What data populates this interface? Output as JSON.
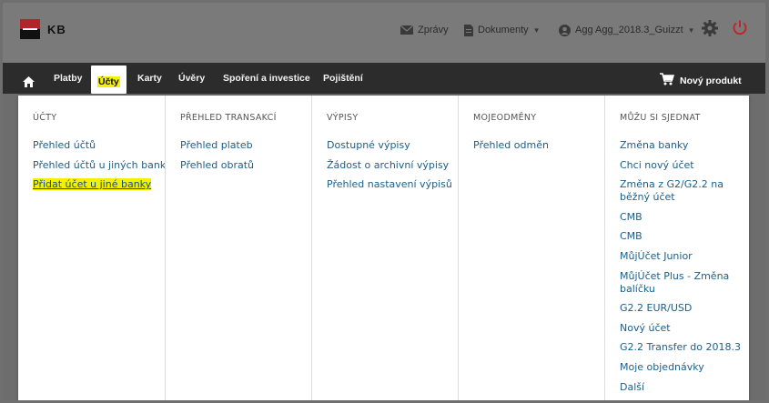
{
  "brand": {
    "logo_text": "KB"
  },
  "top": {
    "messages": "Zprávy",
    "documents": "Dokumenty",
    "user": "Agg Agg_2018.3_Guizzt"
  },
  "nav": {
    "items": [
      "Platby",
      "Účty",
      "Karty",
      "Úvěry",
      "Spoření a investice",
      "Pojištění"
    ],
    "active": "Účty",
    "new_product": "Nový produkt"
  },
  "menu": {
    "columns": [
      {
        "heading": "ÚČTY",
        "links": [
          "Přehled účtů",
          "Přehled účtů u jiných bank",
          "Přidat účet u jiné banky"
        ]
      },
      {
        "heading": "PŘEHLED TRANSAKCÍ",
        "links": [
          "Přehled plateb",
          "Přehled obratů"
        ]
      },
      {
        "heading": "VÝPISY",
        "links": [
          "Dostupné výpisy",
          "Žádost o archivní výpisy",
          "Přehled nastavení výpisů"
        ]
      },
      {
        "heading": "MOJEODMĚNY",
        "links": [
          "Přehled odměn"
        ]
      },
      {
        "heading": "MŮŽU SI SJEDNAT",
        "links": [
          "Změna banky",
          "Chci nový účet",
          "Změna z G2/G2.2 na běžný účet",
          "CMB",
          "CMB",
          "MůjÚčet Junior",
          "MůjÚčet Plus - Změna balíčku",
          "G2.2 EUR/USD",
          "Nový účet",
          "G2.2 Transfer do 2018.3",
          "Moje objednávky",
          "Další"
        ]
      }
    ]
  },
  "colors": {
    "nav_bg": "#2c2c2c",
    "link": "#1b5e8a",
    "highlight": "#f4f000",
    "power_icon": "#c0262d",
    "brand_red": "#b5232a"
  }
}
